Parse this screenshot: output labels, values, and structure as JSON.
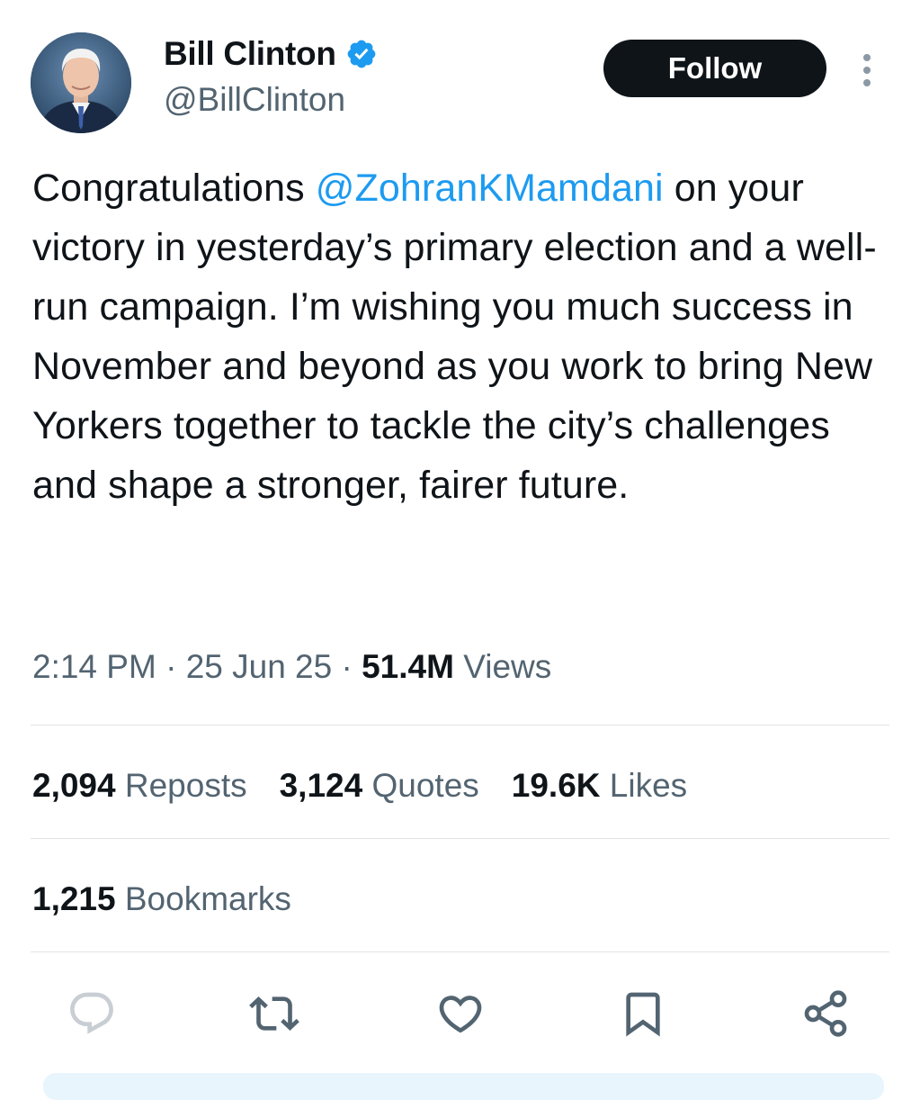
{
  "author": {
    "display_name": "Bill Clinton",
    "handle": "@BillClinton",
    "verified": true
  },
  "follow_label": "Follow",
  "tweet": {
    "prefix": "Congratulations ",
    "mention": "@ZohranKMamdani",
    "body": " on your victory in yesterday’s primary election and a well-run campaign. I’m wishing you much success in November and beyond as you work to bring New Yorkers together to tackle the city’s challenges and shape a stronger, fairer future."
  },
  "meta": {
    "time": "2:14 PM",
    "sep": " · ",
    "date": "25 Jun 25",
    "views_count": "51.4M",
    "views_label": " Views"
  },
  "stats": {
    "reposts_count": "2,094",
    "reposts_label": " Reposts",
    "quotes_count": "3,124",
    "quotes_label": " Quotes",
    "likes_count": "19.6K",
    "likes_label": " Likes",
    "bookmarks_count": "1,215",
    "bookmarks_label": " Bookmarks"
  },
  "icons": {
    "verified": "verified-badge-icon",
    "more": "more-vertical-icon",
    "reply": "reply-icon",
    "repost": "repost-icon",
    "like": "heart-icon",
    "bookmark": "bookmark-icon",
    "share": "share-icon"
  },
  "colors": {
    "accent": "#1d9bf0",
    "text": "#0f1419",
    "muted": "#536471",
    "follow_bg": "#0f1419"
  }
}
